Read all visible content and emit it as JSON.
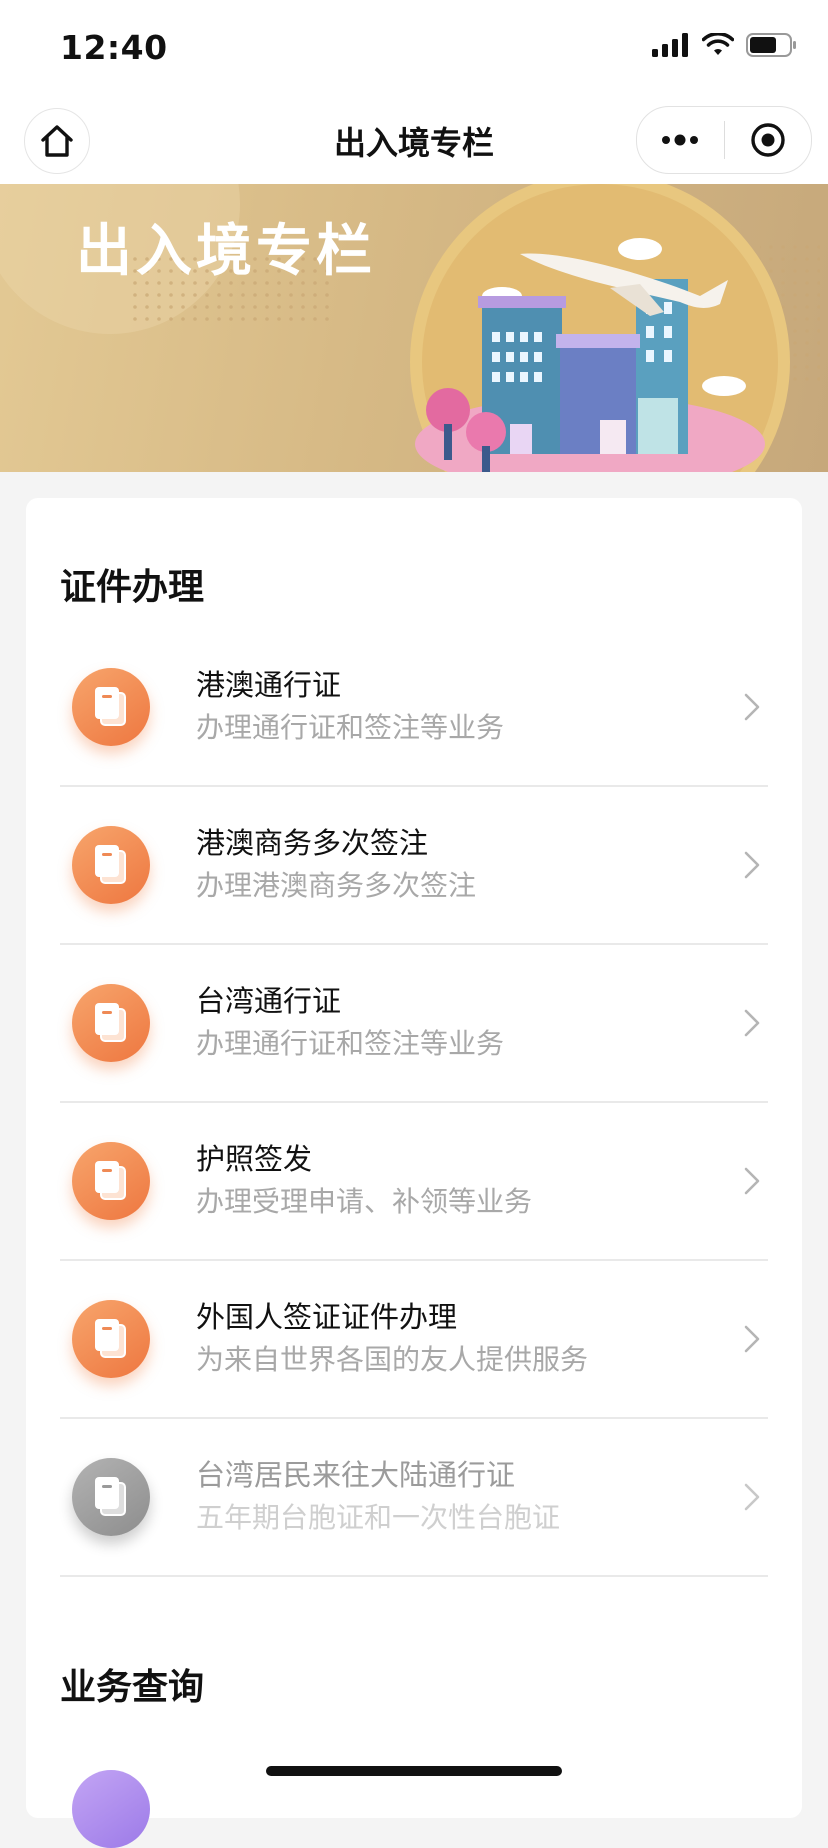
{
  "status": {
    "time": "12:40"
  },
  "nav": {
    "title": "出入境专栏"
  },
  "banner": {
    "title": "出入境专栏"
  },
  "sections": {
    "certificates": {
      "title": "证件办理"
    },
    "query": {
      "title": "业务查询"
    }
  },
  "items": [
    {
      "title": "港澳通行证",
      "subtitle": "办理通行证和签注等业务",
      "enabled": true
    },
    {
      "title": "港澳商务多次签注",
      "subtitle": "办理港澳商务多次签注",
      "enabled": true
    },
    {
      "title": "台湾通行证",
      "subtitle": "办理通行证和签注等业务",
      "enabled": true
    },
    {
      "title": "护照签发",
      "subtitle": "办理受理申请、补领等业务",
      "enabled": true
    },
    {
      "title": "外国人签证证件办理",
      "subtitle": "为来自世界各国的友人提供服务",
      "enabled": true
    },
    {
      "title": "台湾居民来往大陆通行证",
      "subtitle": "五年期台胞证和一次性台胞证",
      "enabled": false
    }
  ],
  "colors": {
    "icon_orange": "#ee7740",
    "icon_gray": "#9a9a9a",
    "banner_gold": "#d6b985"
  }
}
